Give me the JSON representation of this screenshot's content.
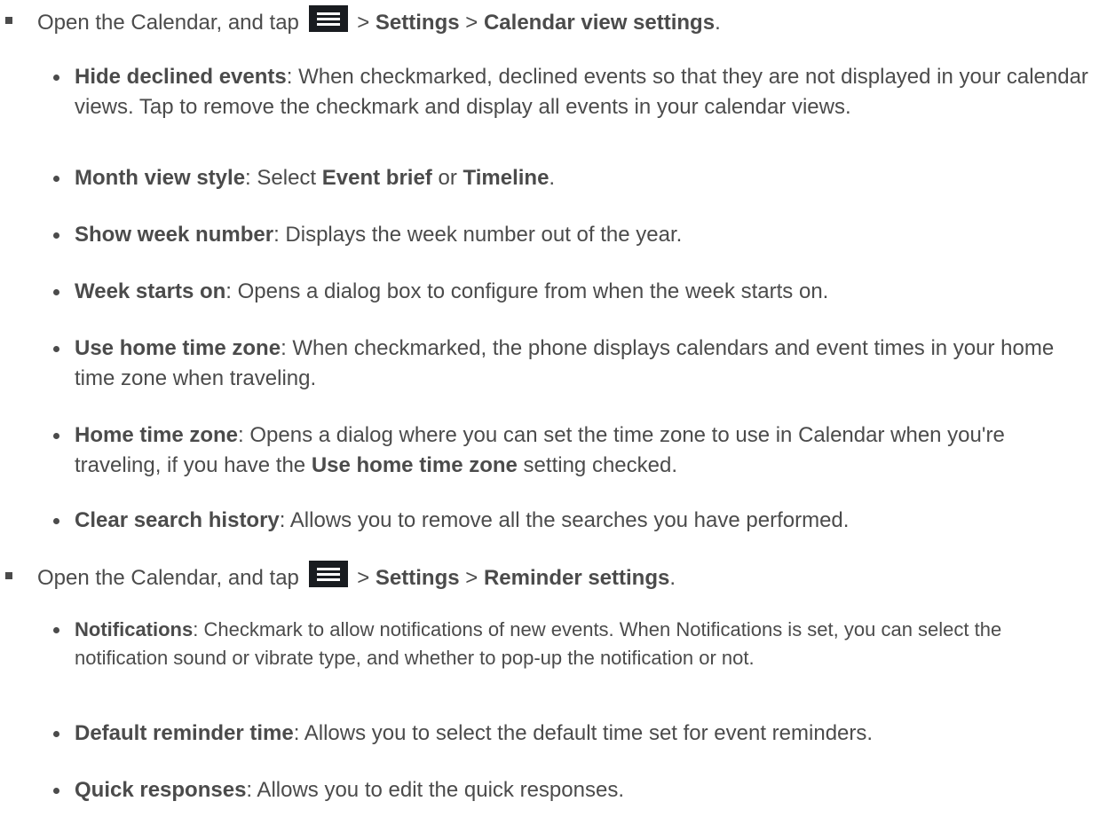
{
  "sections": [
    {
      "intro": {
        "pre": "Open the Calendar, and tap",
        "sep1": ">",
        "b1": "Settings",
        "sep2": ">",
        "b2": "Calendar view settings",
        "end": "."
      },
      "items": [
        {
          "title": "Hide declined events",
          "text": ": When checkmarked, declined events so that they are not displayed in your calendar views. Tap to remove the checkmark and display all events in your calendar views."
        },
        {
          "title": "Month view style",
          "text": ": Select ",
          "b1": "Event brief",
          "mid": " or ",
          "b2": "Timeline",
          "end": "."
        },
        {
          "title": "Show week number",
          "text": ": Displays the week number out of the year."
        },
        {
          "title": "Week starts on",
          "text": ": Opens a dialog box to configure from when the week starts on."
        },
        {
          "title": "Use home time zone",
          "text": ": When checkmarked, the phone displays calendars and event times in your home time zone when traveling."
        },
        {
          "title": "Home time zone",
          "text": ": Opens a dialog where you can set the time zone to use in Calendar when you're traveling, if you have the ",
          "b1": "Use home time zone",
          "end": " setting checked."
        },
        {
          "title": "Clear search history",
          "text": ": Allows you to remove all the searches you have performed."
        }
      ]
    },
    {
      "intro": {
        "pre": "Open the Calendar, and tap",
        "sep1": ">",
        "b1": "Settings",
        "sep2": ">",
        "b2": "Reminder settings",
        "end": "."
      },
      "items": [
        {
          "title": "Notifications",
          "text": ": Checkmark to allow notifications of new events. When Notifications is set, you can select the notification sound or vibrate type, and whether to pop-up the notification or not."
        },
        {
          "title": "Default reminder time",
          "text": ": Allows you to select the default time set for event reminders."
        },
        {
          "title": "Quick responses",
          "text": ": Allows you to edit the quick responses."
        }
      ]
    }
  ],
  "icons": {
    "menu": "menu-icon"
  },
  "colors": {
    "text": "#4b4b4b",
    "icon_bg": "#191c20"
  }
}
